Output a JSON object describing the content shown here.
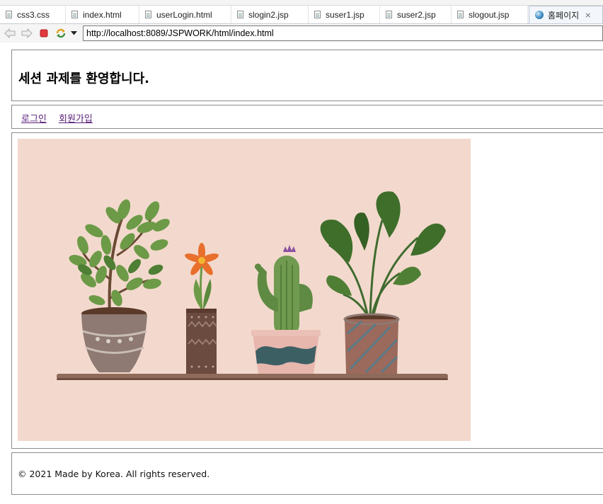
{
  "tabs": [
    {
      "label": "css3.css",
      "kind": "file",
      "active": false
    },
    {
      "label": "index.html",
      "kind": "file",
      "active": false
    },
    {
      "label": "userLogin.html",
      "kind": "file",
      "active": false
    },
    {
      "label": "slogin2.jsp",
      "kind": "file",
      "active": false
    },
    {
      "label": "suser1.jsp",
      "kind": "file",
      "active": false
    },
    {
      "label": "suser2.jsp",
      "kind": "file",
      "active": false
    },
    {
      "label": "slogout.jsp",
      "kind": "file",
      "active": false
    },
    {
      "label": "홈페이지",
      "kind": "browser",
      "active": true
    }
  ],
  "browser": {
    "url": "http://localhost:8089/JSPWORK/html/index.html"
  },
  "page": {
    "heading": "세션 과제를 환영합니다.",
    "nav": {
      "login": "로그인",
      "signup": "회원가입"
    },
    "footer": "© 2021 Made by Korea. All rights reserved."
  },
  "colors": {
    "link": "#5a1f78",
    "illustration_bg": "#f3d9cd",
    "stop_button": "#e0393e"
  },
  "icons": {
    "back": "arrow-left-icon",
    "forward": "arrow-right-icon",
    "stop": "stop-icon",
    "refresh": "refresh-icon",
    "menu": "dropdown-arrow-icon"
  }
}
